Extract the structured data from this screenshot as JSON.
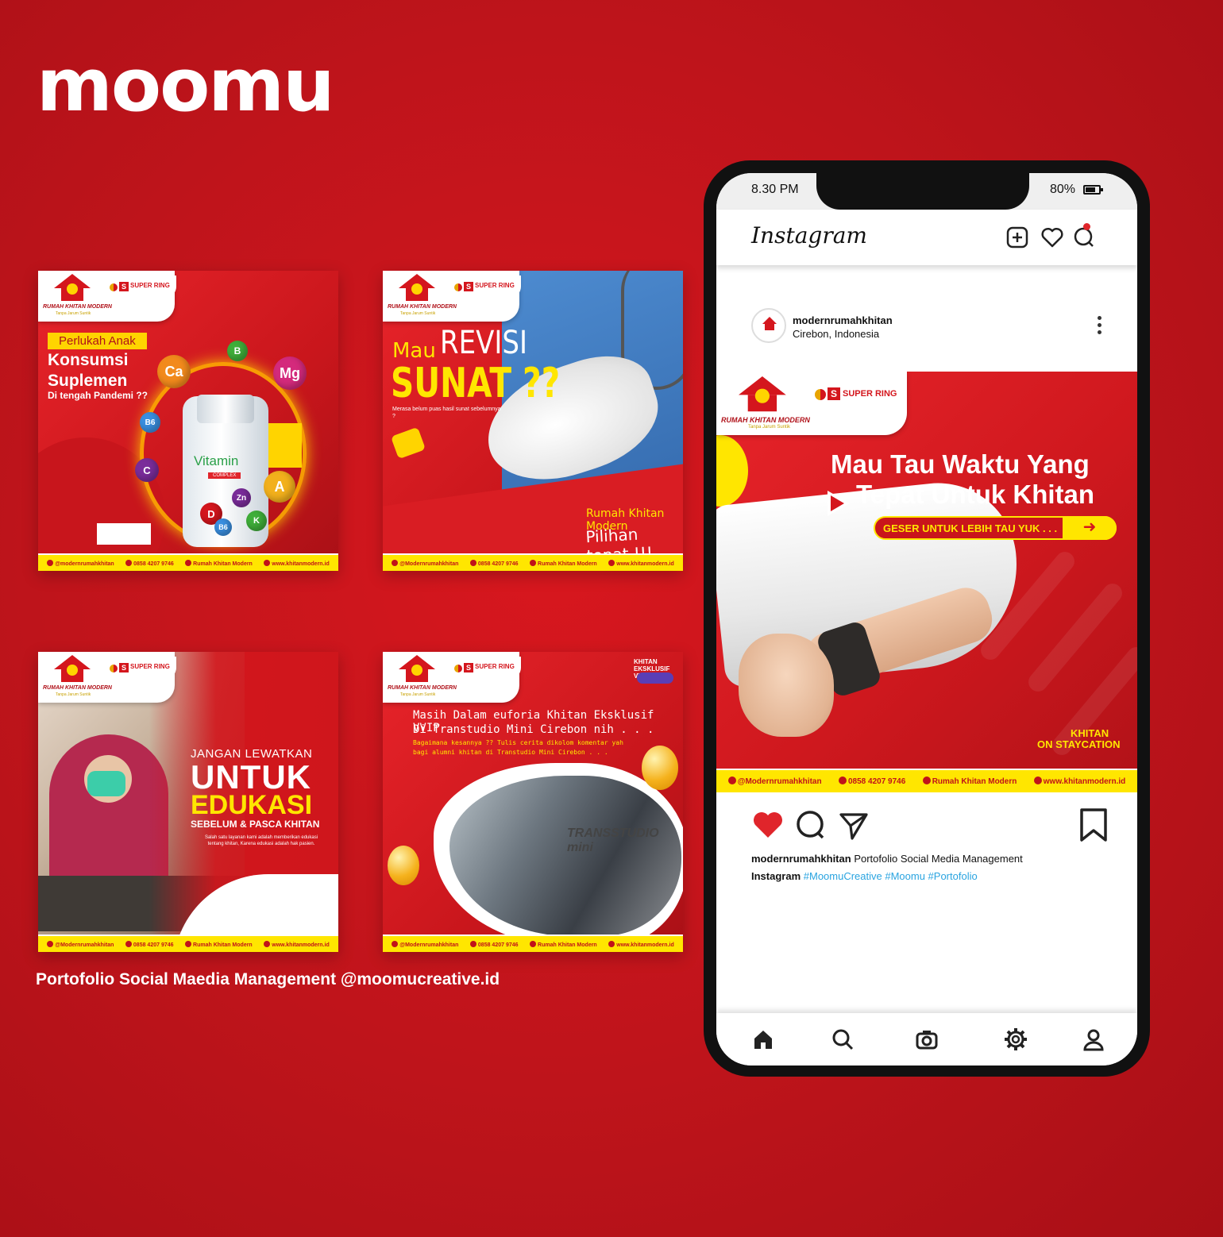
{
  "brand": {
    "logo_text": "moomu"
  },
  "caption": "Portofolio Social Maedia Management @moomucreative.id",
  "colors": {
    "background": "#c4141b",
    "accent_yellow": "#ffe600",
    "hashtag_blue": "#2aa4e0",
    "heart_red": "#e0252b"
  },
  "shared_post": {
    "clinic_name": "RUMAH KHITAN MODERN",
    "clinic_tagline": "Tanpa Jarum Suntik",
    "sponsor": "SUPER RING",
    "footer": {
      "instagram": "@modernrumahkhitan",
      "instagram_alt": "@Modernrumahkhitan",
      "phone": "0858 4207 9746",
      "facebook": "Rumah Khitan Modern",
      "website": "www.khitanmodern.id"
    }
  },
  "posts": [
    {
      "highlight": "Perlukah Anak",
      "line1": "Konsumsi",
      "line2": "Suplemen",
      "line3": "Di tengah Pandemi ??",
      "bottle_label": "Vitamin",
      "bottle_sub": "COMPLEX",
      "vitamins": [
        "Ca",
        "B",
        "Mg",
        "B6",
        "C",
        "A",
        "D",
        "Zn",
        "B6",
        "K"
      ]
    },
    {
      "mau": "Mau",
      "revisi": "REVISI",
      "sunat": "SUNAT ??",
      "question": "Merasa belum puas hasil sunat sebelumnya ?",
      "brand_line": "Rumah Khitan Modern",
      "tagline": "Pilihan tepat !!!"
    },
    {
      "pre": "JANGAN LEWATKAN",
      "big1": "UNTUK",
      "big2": "EDUKASI",
      "sub": "SEBELUM & PASCA KHITAN",
      "desc": "Salah satu layanan kami adalah memberikan edukasi tentang khitan, Karena edukasi adalah hak pasien."
    },
    {
      "badge": "KHITAN EKSKLUSIF VVIP",
      "line1": "Masih Dalam euforia Khitan Eksklusif VVIP",
      "line2": "Di Transtudio Mini Cirebon  nih . . .",
      "line3": "Bagaimana kesannya ?? Tulis cerita dikolom komentar yah",
      "line4": "bagi alumni khitan di Transtudio Mini Cirebon . . .",
      "venue_logo": "TRANSSTUDIO mini"
    }
  ],
  "phone": {
    "status": {
      "time": "8.30 PM",
      "battery": "80%"
    },
    "app_name": "Instagram",
    "header_icons": [
      "add-post-icon",
      "heart-outline-icon",
      "message-icon"
    ],
    "post": {
      "username": "modernrumahkhitan",
      "location": "Cirebon, Indonesia",
      "headline1": "Mau Tau Waktu Yang",
      "headline2": "Tepat Untuk Khitan",
      "cta": "GESER UNTUK LEBIH TAU YUK . . .",
      "khitan1": "KHITAN",
      "khitan2": "ON STAYCATION",
      "liked": true,
      "caption_user": "modernrumahkhitan",
      "caption_text": "Portofolio Social Media Management",
      "caption_user2": "Instagram",
      "hashtags": "#MoomuCreative #Moomu #Portofolio"
    },
    "nav_icons": [
      "home-icon",
      "search-icon",
      "camera-icon",
      "settings-icon",
      "profile-icon"
    ]
  }
}
